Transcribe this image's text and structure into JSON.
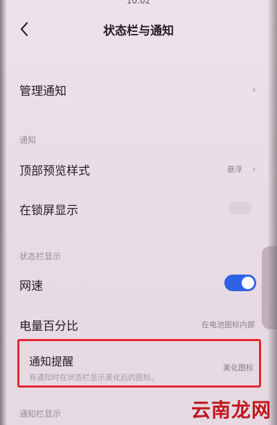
{
  "status_bar": {
    "time": "10:02"
  },
  "header": {
    "title": "状态栏与通知"
  },
  "rows": {
    "manage_notifications": {
      "label": "管理通知"
    },
    "top_preview_style": {
      "label": "顶部预览样式",
      "value": "悬浮"
    },
    "lockscreen_display": {
      "label": "在锁屏显示"
    },
    "network_speed": {
      "label": "网速"
    },
    "battery_percent": {
      "label": "电量百分比",
      "value": "在电池图标内部"
    },
    "notification_reminder": {
      "label": "通知提醒",
      "sub": "有通知时在状态栏显示美化后的图标。",
      "value": "美化图标"
    }
  },
  "sections": {
    "notifications": "通知",
    "status_bar_display": "状态栏显示",
    "notification_bar_display": "通知栏显示"
  },
  "watermark": {
    "text": "云南龙网"
  },
  "colors": {
    "accent": "#2f63e6",
    "highlight_border": "#e3242b",
    "watermark": "#c0171e"
  }
}
